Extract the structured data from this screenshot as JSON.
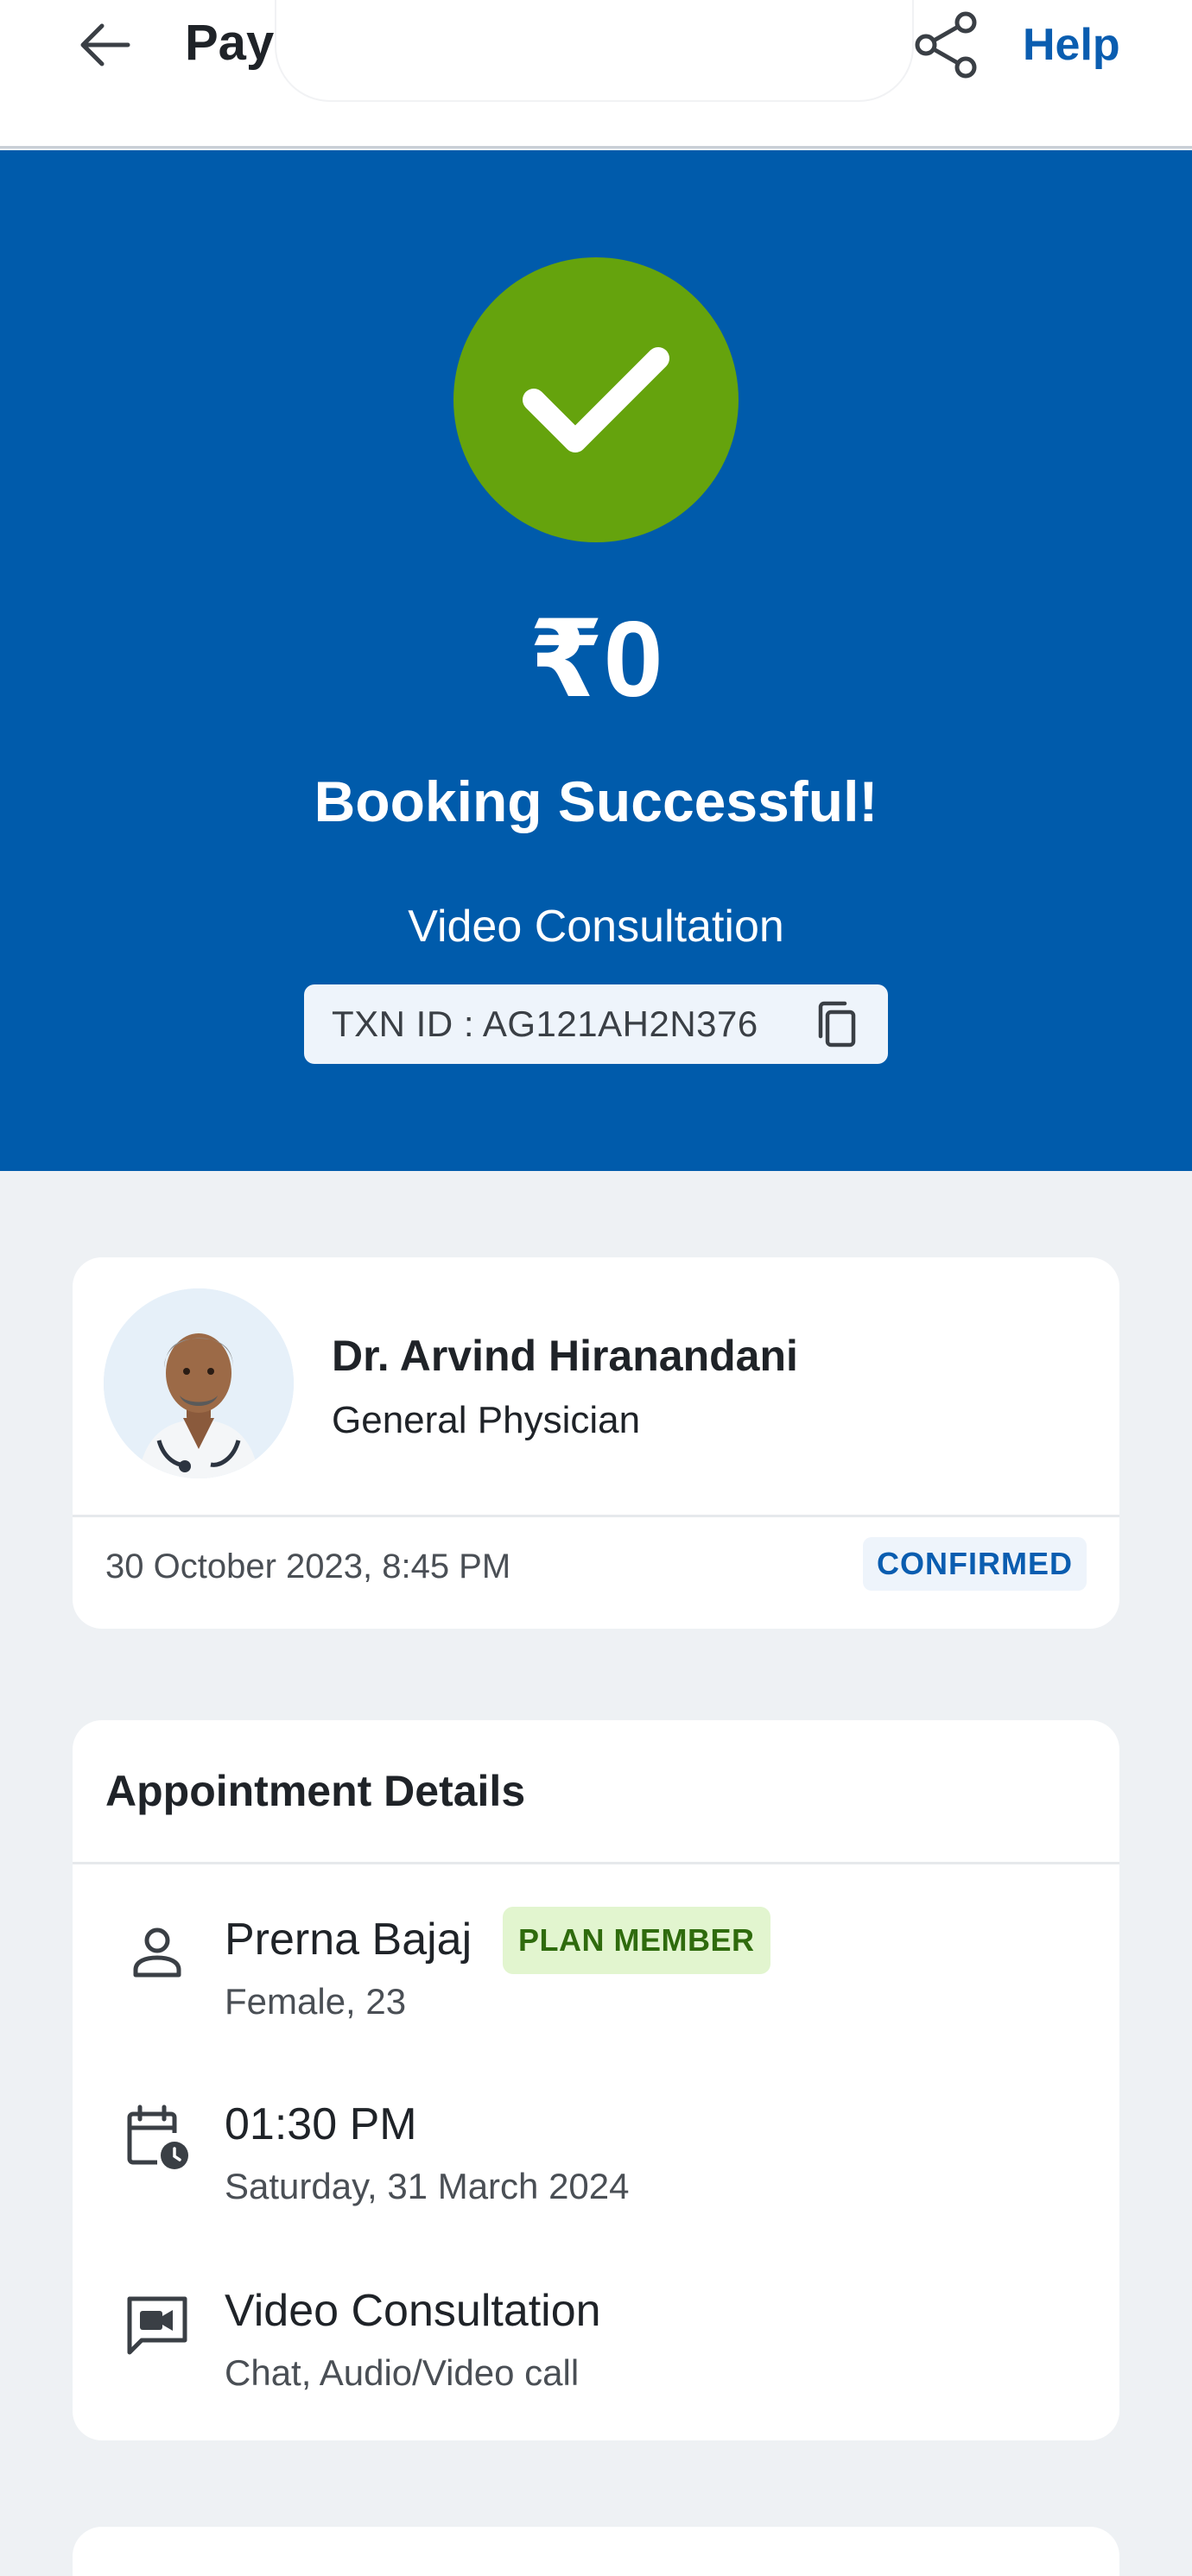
{
  "header": {
    "title": "Pay",
    "help_label": "Help",
    "back_icon": "arrow-left-icon",
    "share_icon": "share-icon"
  },
  "hero": {
    "amount": "₹0",
    "status": "Booking Successful!",
    "consultation_type": "Video Consultation",
    "txn_label": "TXN ID : AG121AH2N376",
    "success_icon": "check-icon",
    "copy_icon": "copy-icon"
  },
  "doctor": {
    "name": "Dr. Arvind Hiranandani",
    "specialty": "General Physician",
    "datetime": "30 October 2023, 8:45 PM",
    "status_badge": "CONFIRMED"
  },
  "appointment": {
    "heading": "Appointment Details",
    "patient": {
      "name": "Prerna Bajaj",
      "badge": "PLAN MEMBER",
      "info": "Female, 23",
      "icon": "person-icon"
    },
    "time": {
      "time": "01:30 PM",
      "date": "Saturday, 31 March 2024",
      "icon": "calendar-clock-icon"
    },
    "mode": {
      "type": "Video Consultation",
      "info": "Chat, Audio/Video call",
      "icon": "video-chat-icon"
    }
  },
  "colors": {
    "brand_blue": "#005bab",
    "success_green": "#65a30d",
    "link_blue": "#0a5db0",
    "page_bg": "#eef1f4"
  }
}
